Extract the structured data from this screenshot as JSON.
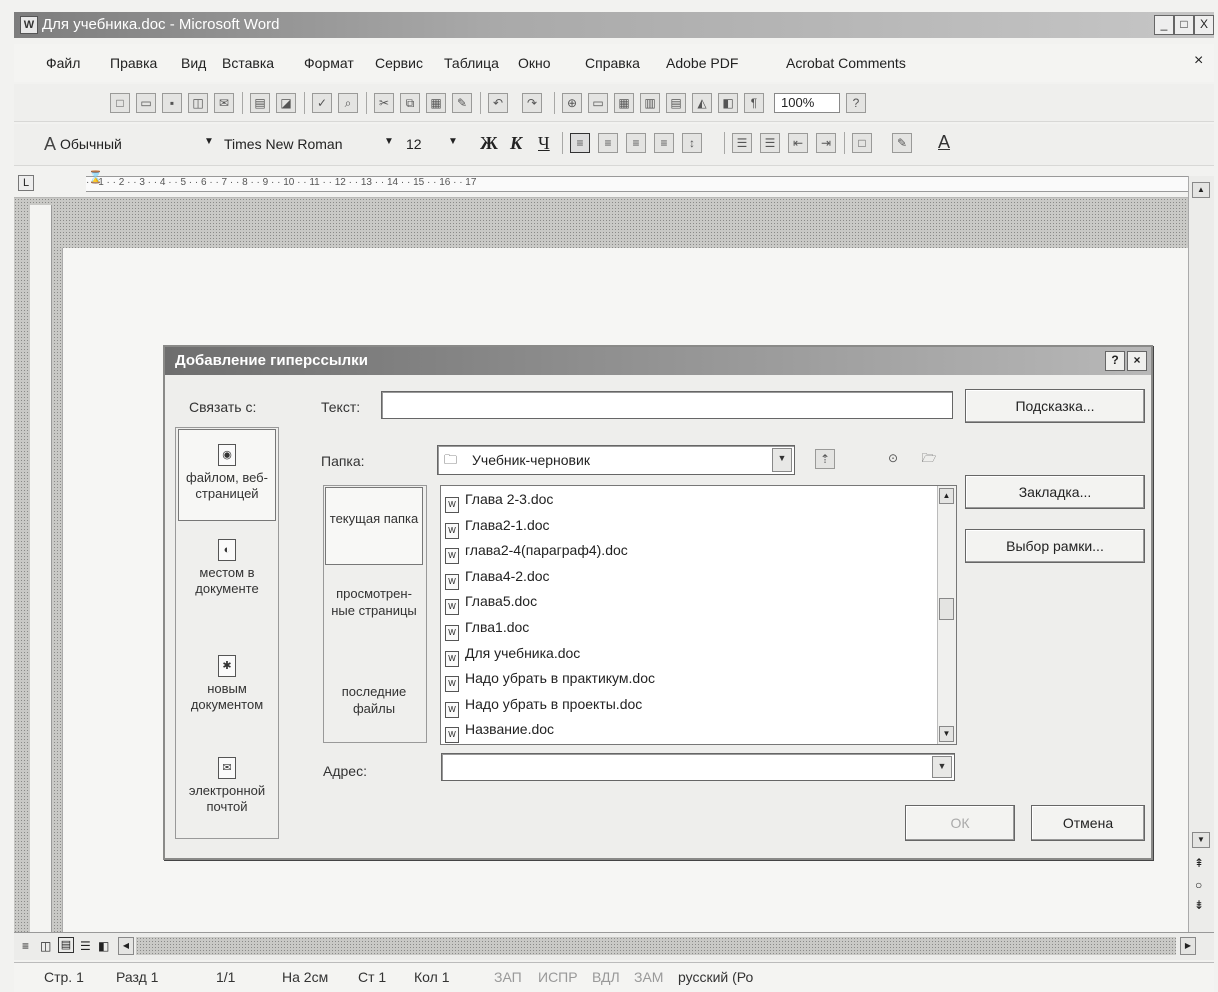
{
  "window": {
    "title": "Для учебника.doc - Microsoft Word",
    "minimize": "_",
    "maximize": "□",
    "close": "X",
    "doc_close": "×"
  },
  "menu": [
    {
      "label": "Файл"
    },
    {
      "label": "Правка"
    },
    {
      "label": "Вид"
    },
    {
      "label": "Вставка"
    },
    {
      "label": "Формат"
    },
    {
      "label": "Сервис"
    },
    {
      "label": "Таблица"
    },
    {
      "label": "Окно"
    },
    {
      "label": "Справка"
    },
    {
      "label": "Adobe PDF"
    },
    {
      "label": "Acrobat Comments"
    }
  ],
  "standard_toolbar": {
    "zoom": "100%"
  },
  "formatting_toolbar": {
    "style_icon": "A",
    "style": "Обычный",
    "font": "Times New Roman",
    "size": "12",
    "bold": "Ж",
    "italic": "К",
    "underline": "Ч",
    "font_color": "A"
  },
  "ruler": {
    "corner": "L",
    "ticks": "· · 1 · · 2 · · 3 · · 4 · · 5 · · 6 · · 7 · · 8 · · 9 · · 10 · · 11 · · 12 · · 13 · · 14 · · 15 · · 16 · · 17"
  },
  "dialog": {
    "title": "Добавление гиперссылки",
    "help": "?",
    "close": "×",
    "link_to_label": "Связать с:",
    "text_label": "Текст:",
    "text_value": "",
    "screentip_button": "Подсказка...",
    "link_targets": [
      {
        "label": "файлом, веб-страницей"
      },
      {
        "label": "местом в документе"
      },
      {
        "label": "новым документом"
      },
      {
        "label": "электронной почтой"
      }
    ],
    "folder_label": "Папка:",
    "folder_value": "Учебник-черновик",
    "nav": [
      {
        "label": "текущая папка"
      },
      {
        "label": "просмотрен-ные страницы"
      },
      {
        "label": "последние файлы"
      }
    ],
    "files": [
      "Глава 2-3.doc",
      "Глава2-1.doc",
      "глава2-4(параграф4).doc",
      "Глава4-2.doc",
      "Глава5.doc",
      "Глва1.doc",
      "Для учебника.doc",
      "Надо убрать в практикум.doc",
      "Надо убрать в проекты.doc",
      "Название.doc"
    ],
    "bookmark_button": "Закладка...",
    "target_frame_button": "Выбор рамки...",
    "address_label": "Адрес:",
    "address_value": "",
    "ok_button": "ОК",
    "cancel_button": "Отмена"
  },
  "status": {
    "page": "Стр. 1",
    "section": "Разд 1",
    "pages": "1/1",
    "at": "На 2см",
    "line": "Ст 1",
    "col": "Кол 1",
    "rec": "ЗАП",
    "trk": "ИСПР",
    "ext": "ВДЛ",
    "ovr": "ЗАМ",
    "lang": "русский (Ро"
  }
}
